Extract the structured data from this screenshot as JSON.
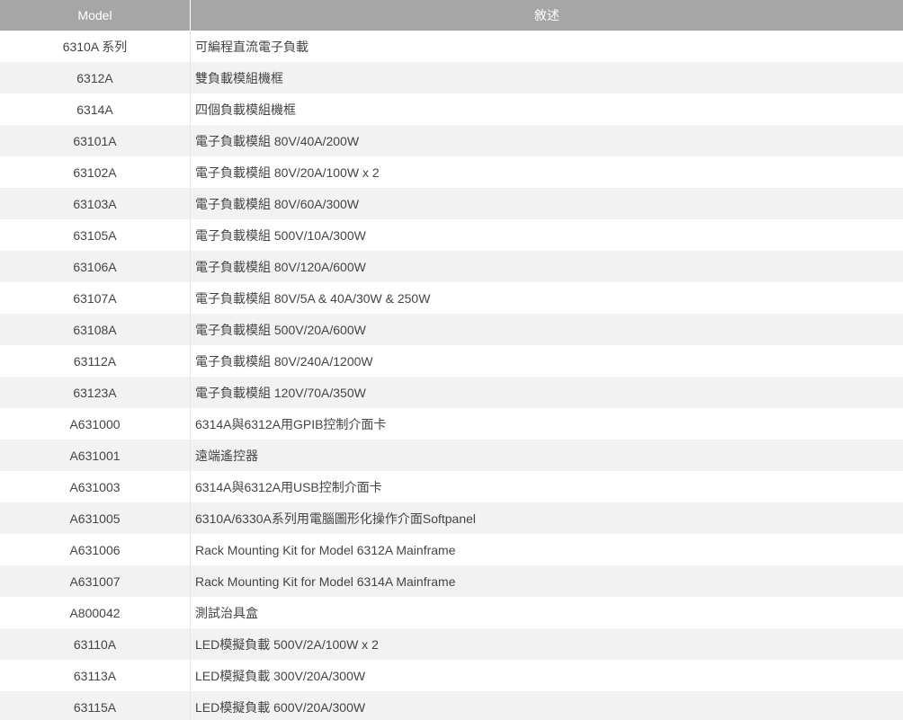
{
  "table": {
    "headers": {
      "model": "Model",
      "description": "敘述"
    },
    "rows": [
      {
        "model": "6310A 系列",
        "description": "可編程直流電子負載"
      },
      {
        "model": "6312A",
        "description": "雙負載模組機框"
      },
      {
        "model": "6314A",
        "description": "四個負載模組機框"
      },
      {
        "model": "63101A",
        "description": "電子負載模組 80V/40A/200W"
      },
      {
        "model": "63102A",
        "description": "電子負載模組 80V/20A/100W x 2"
      },
      {
        "model": "63103A",
        "description": "電子負載模組 80V/60A/300W"
      },
      {
        "model": "63105A",
        "description": "電子負載模組 500V/10A/300W"
      },
      {
        "model": "63106A",
        "description": "電子負載模組 80V/120A/600W"
      },
      {
        "model": "63107A",
        "description": "電子負載模組 80V/5A & 40A/30W & 250W"
      },
      {
        "model": "63108A",
        "description": "電子負載模組 500V/20A/600W"
      },
      {
        "model": "63112A",
        "description": "電子負載模組 80V/240A/1200W"
      },
      {
        "model": "63123A",
        "description": "電子負載模組 120V/70A/350W"
      },
      {
        "model": "A631000",
        "description": "6314A與6312A用GPIB控制介面卡"
      },
      {
        "model": "A631001",
        "description": "遠端遙控器"
      },
      {
        "model": "A631003",
        "description": "6314A與6312A用USB控制介面卡"
      },
      {
        "model": "A631005",
        "description": "6310A/6330A系列用電腦圖形化操作介面Softpanel"
      },
      {
        "model": "A631006",
        "description": "Rack Mounting Kit for Model 6312A Mainframe"
      },
      {
        "model": "A631007",
        "description": "Rack Mounting Kit for Model 6314A Mainframe"
      },
      {
        "model": "A800042",
        "description": "測試治具盒"
      },
      {
        "model": "63110A",
        "description": "LED模擬負載 500V/2A/100W x 2"
      },
      {
        "model": "63113A",
        "description": "LED模擬負載 300V/20A/300W"
      },
      {
        "model": "63115A",
        "description": "LED模擬負載 600V/20A/300W"
      }
    ]
  },
  "colors": {
    "header_bg": "#a6a6a6",
    "header_text": "#ffffff",
    "row_alt_bg": "#f2f2f2",
    "text": "#444444"
  }
}
